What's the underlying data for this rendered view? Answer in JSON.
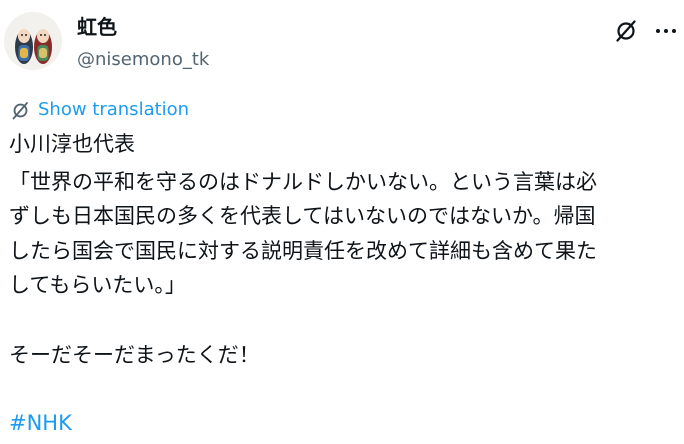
{
  "user": {
    "display_name": "虹色",
    "handle": "@nisemono_tk"
  },
  "translate": {
    "label": "Show translation",
    "icon": "translate-globe-icon"
  },
  "actions": {
    "grok_icon": "grok-icon",
    "more_icon": "more-horizontal-icon"
  },
  "post": {
    "lines": [
      "小川淳也代表",
      "「世界の平和を守るのはドナルドしかいない。という言葉は必",
      "ずしも日本国民の多くを代表してはいないのではないか。帰国",
      "したら国会で国民に対する説明責任を改めて詳細も含めて果た",
      "してもらいたい。」",
      "そーだそーだまったくだ！"
    ],
    "hashtag": "#NHK"
  },
  "colors": {
    "text": "#0f1419",
    "secondary": "#536471",
    "accent": "#1d9bf0"
  }
}
